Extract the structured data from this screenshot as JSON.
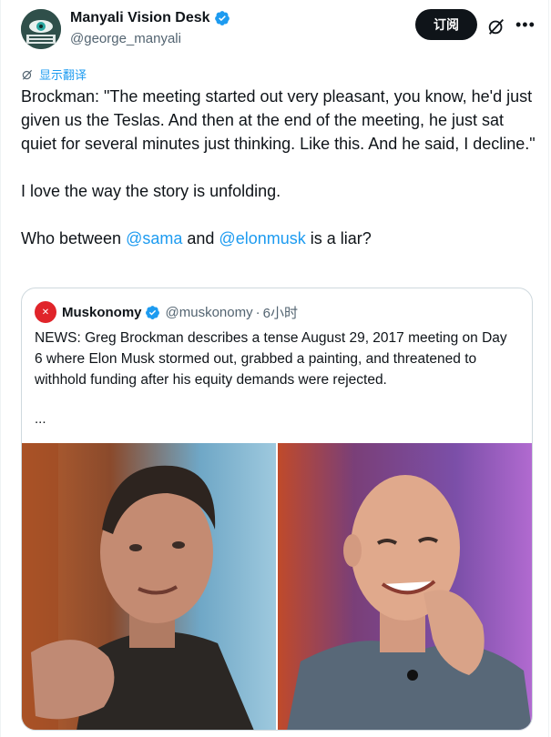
{
  "author": {
    "display_name": "Manyali Vision Desk",
    "handle": "@george_manyali",
    "avatar_icon": "eye-logo-icon",
    "verified": true
  },
  "actions": {
    "subscribe_label": "订阅",
    "grok_icon": "grok-icon",
    "more_label": "•••"
  },
  "translate_label": "显示翻译",
  "tweet": {
    "paragraph1": "Brockman: \"The meeting started out very pleasant, you know, he'd just given us the Teslas. And then at the end of the meeting, he just sat quiet for several minutes just thinking. Like this. And he said, I decline.\"",
    "paragraph2": "I love the way the story is unfolding.",
    "p3_before": "Who between ",
    "mention1": "@sama",
    "p3_middle": " and ",
    "mention2": "@elonmusk",
    "p3_after": " is a liar?"
  },
  "quote": {
    "name": "Muskonomy",
    "avatar_label": "✕",
    "handle": "@muskonomy",
    "dot": "·",
    "time": "6小时",
    "body": "NEWS: Greg Brockman describes a tense August 29, 2017 meeting on Day 6 where Elon Musk stormed out, grabbed a painting, and threatened to withhold funding after his equity demands were rejected.",
    "ellipsis": "..."
  },
  "colors": {
    "accent": "#1d9bf0",
    "text": "#0f1419",
    "muted": "#536471",
    "border": "#cfd9de",
    "quote_avatar": "#e0242a"
  }
}
